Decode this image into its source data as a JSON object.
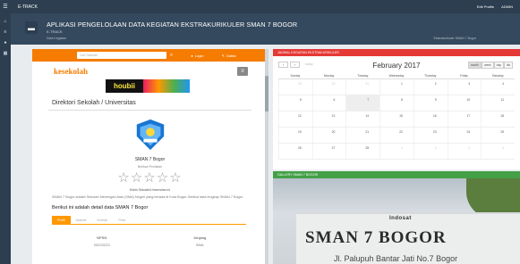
{
  "topbar": {
    "brand": "E-TRACK",
    "right_items": [
      "Edit Profile",
      "ADMIN"
    ]
  },
  "sidebar": {
    "icons": [
      "home-icon",
      "list-icon",
      "user-icon",
      "calendar-icon"
    ]
  },
  "header": {
    "title": "APLIKASI PENGELOLAAN DATA KEGIATAN EKSTRAKURIKULER SMAN 7 BOGOR",
    "subtitle": "E-TRACK",
    "crumbs": [
      "Data Kegiatan",
      "Ekstrakurikuler SMAN 7 Bogor"
    ]
  },
  "left_panel": {
    "search_placeholder": "Cari Sekolah",
    "login_label": "Login",
    "daftar_label": "Daftar",
    "logo_text": "kesekolah",
    "banner_text": "houbii",
    "directory_title": "Direktori Sekolah / Universitas",
    "school_name": "SMAN 7 Bogor",
    "rating_label": "Berikan Penilaian",
    "stars": "☆☆☆☆☆",
    "claim_text": "Klaim Sekolah/Universitas ini",
    "description": "SMAN 7 Bogor adalah Sekolah Menengah Atas (SMA) Negeri yang berada di Kota Bogor. Berikut data lengkap SMAN 7 Bogor.",
    "detail_title": "Berikut ini adalah detail data SMAN 7 Bogor",
    "tabs": [
      "Profil",
      "Alamat",
      "Kontak",
      "Peta"
    ],
    "info": [
      {
        "label": "NPSN",
        "value": "20222223"
      },
      {
        "label": "Jenjang",
        "value": "SMA"
      }
    ]
  },
  "calendar": {
    "header": "JADWAL KEGIATAN EKSTRAKURIKULER",
    "today_label": "today",
    "month": "February 2017",
    "views": [
      "month",
      "week",
      "day",
      "list"
    ],
    "dows": [
      "Sunday",
      "Monday",
      "Tuesday",
      "Wednesday",
      "Thursday",
      "Friday",
      "Saturday"
    ],
    "weeks": [
      [
        "29",
        "30",
        "31",
        "1",
        "2",
        "3",
        "4"
      ],
      [
        "5",
        "6",
        "7",
        "8",
        "9",
        "10",
        "11"
      ],
      [
        "12",
        "13",
        "14",
        "15",
        "16",
        "17",
        "18"
      ],
      [
        "19",
        "20",
        "21",
        "22",
        "23",
        "24",
        "25"
      ],
      [
        "26",
        "27",
        "28",
        "1",
        "2",
        "3",
        "4"
      ]
    ]
  },
  "gallery": {
    "header": "GALLERY SMAN 7 BOGOR",
    "sign_small": "Indosat",
    "sign_big": "SMAN 7 BOGOR",
    "sign_address": "Jl. Palupuh Bantar Jati No.7 Bogor"
  }
}
